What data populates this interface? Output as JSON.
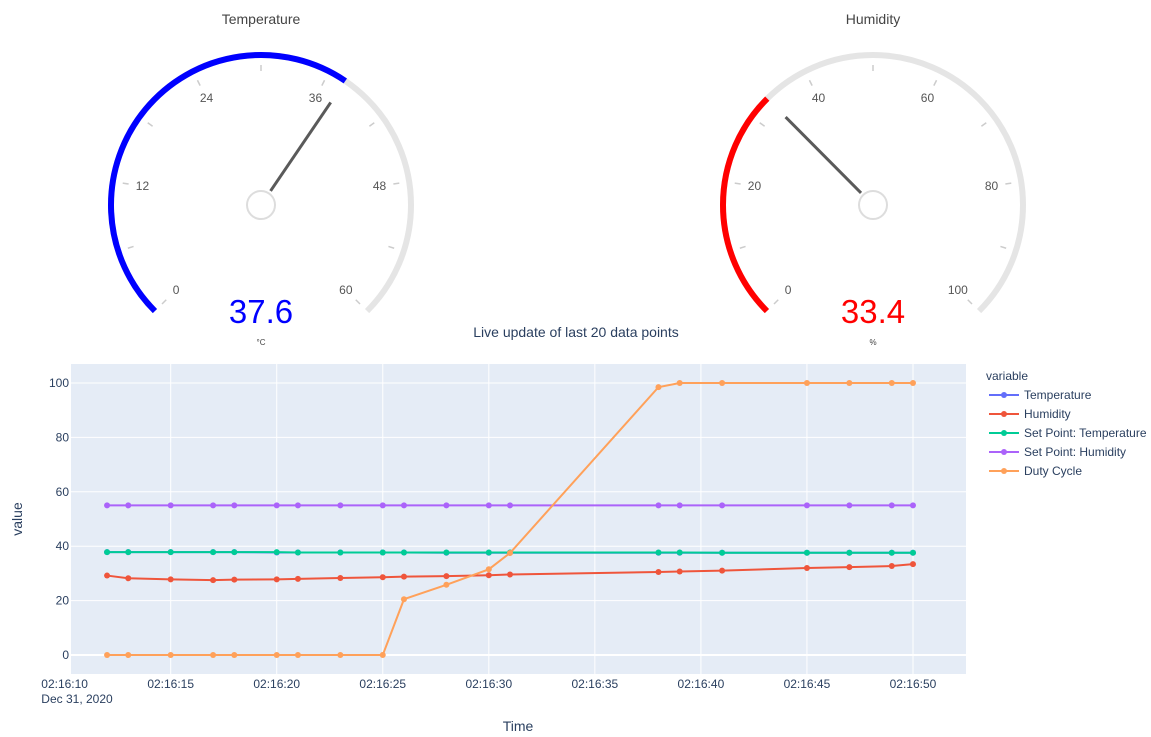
{
  "gauges": [
    {
      "title": "Temperature",
      "value": 37.6,
      "value_text": "37.6",
      "unit": "°C",
      "min": 0,
      "max": 60,
      "ticks": [
        "0",
        "12",
        "24",
        "36",
        "48",
        "60"
      ],
      "tick_values": [
        0,
        12,
        24,
        36,
        48,
        60
      ],
      "bar_color": "#0000ff"
    },
    {
      "title": "Humidity",
      "value": 33.4,
      "value_text": "33.4",
      "unit": "%",
      "min": 0,
      "max": 100,
      "ticks": [
        "0",
        "20",
        "40",
        "60",
        "80",
        "100"
      ],
      "tick_values": [
        0,
        20,
        40,
        60,
        80,
        100
      ],
      "bar_color": "#ff0000"
    }
  ],
  "chart_data": {
    "type": "line",
    "title": "Live update of last 20 data points",
    "xlabel": "Time",
    "ylabel": "value",
    "x_date_label": "Dec 31, 2020",
    "x": [
      "02:16:12",
      "02:16:13",
      "02:16:15",
      "02:16:17",
      "02:16:18",
      "02:16:20",
      "02:16:21",
      "02:16:23",
      "02:16:25",
      "02:16:26",
      "02:16:28",
      "02:16:30",
      "02:16:31",
      "02:16:38",
      "02:16:39",
      "02:16:41",
      "02:16:45",
      "02:16:47",
      "02:16:49",
      "02:16:50"
    ],
    "x_ticks": [
      "02:16:10",
      "02:16:15",
      "02:16:20",
      "02:16:25",
      "02:16:30",
      "02:16:35",
      "02:16:40",
      "02:16:45",
      "02:16:50"
    ],
    "y_ticks": [
      "0",
      "20",
      "40",
      "60",
      "80",
      "100"
    ],
    "xlim": [
      "02:16:10.3",
      "02:16:52.5"
    ],
    "ylim": [
      -7,
      107
    ],
    "grid": true,
    "legend_title": "variable",
    "legend_position": "right",
    "series": [
      {
        "name": "Temperature",
        "color": "#636efa",
        "values": [
          37.8,
          37.8,
          37.8,
          37.8,
          37.8,
          37.7,
          37.7,
          37.7,
          37.7,
          37.7,
          37.6,
          37.6,
          37.6,
          37.6,
          37.6,
          37.6,
          37.6,
          37.6,
          37.6,
          37.6
        ]
      },
      {
        "name": "Humidity",
        "color": "#ef553b",
        "values": [
          29.2,
          28.2,
          27.8,
          27.5,
          27.7,
          27.8,
          28.0,
          28.3,
          28.6,
          28.8,
          29.0,
          29.3,
          29.6,
          30.5,
          30.7,
          31.0,
          32.0,
          32.3,
          32.7,
          33.4
        ]
      },
      {
        "name": "Set Point: Temperature",
        "color": "#00cc96",
        "values": [
          37.8,
          37.8,
          37.8,
          37.8,
          37.8,
          37.8,
          37.7,
          37.7,
          37.7,
          37.7,
          37.7,
          37.7,
          37.7,
          37.7,
          37.7,
          37.6,
          37.6,
          37.6,
          37.6,
          37.6
        ]
      },
      {
        "name": "Set Point: Humidity",
        "color": "#ab63fa",
        "values": [
          55,
          55,
          55,
          55,
          55,
          55,
          55,
          55,
          55,
          55,
          55,
          55,
          55,
          55,
          55,
          55,
          55,
          55,
          55,
          55
        ]
      },
      {
        "name": "Duty Cycle",
        "color": "#ffa15a",
        "values": [
          0,
          0,
          0,
          0,
          0,
          0,
          0,
          0,
          0,
          20.5,
          25.8,
          31.5,
          37.5,
          98.5,
          100,
          100,
          100,
          100,
          100,
          100
        ]
      }
    ]
  }
}
